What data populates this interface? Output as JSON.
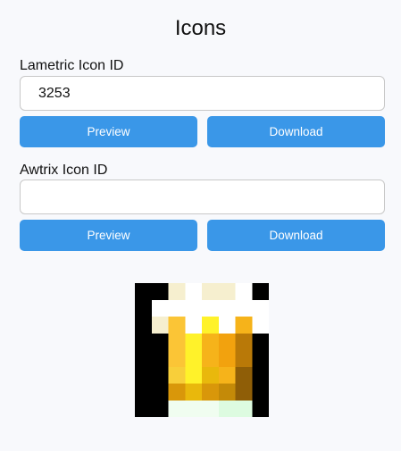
{
  "page": {
    "title": "Icons"
  },
  "lametric": {
    "label": "Lametric Icon ID",
    "value": "3253",
    "placeholder": "",
    "preview_label": "Preview",
    "download_label": "Download"
  },
  "awtrix": {
    "label": "Awtrix Icon ID",
    "value": "",
    "placeholder": "",
    "preview_label": "Preview",
    "download_label": "Download"
  },
  "preview_icon": {
    "icon": "beer-mug-icon",
    "palette": {
      "k": "#000000",
      "w": "#ffffff",
      "c": "#f6efcf",
      "p": "#f2e8c4",
      "a": "#fbc536",
      "y": "#fff22a",
      "g": "#f6b31a",
      "o": "#f2a20e",
      "b": "#b97908",
      "d": "#8f5e07",
      "m": "#f8cf3a",
      "n": "#e9b80c",
      "q": "#d9970a",
      "r": "#c48a08",
      "e": "#ddfbe0",
      "f": "#f0fdf0",
      ".": "#f8f9fc"
    },
    "pixels": [
      "kkcwccwkk.",
      "kwwwwwwwkk",
      "kcawywgwkk",
      "kkaygobkek",
      "kkaygobkke",
      "kkmyngdkwk",
      "kkqnqrdkek",
      "kkfffeek.k"
    ]
  }
}
